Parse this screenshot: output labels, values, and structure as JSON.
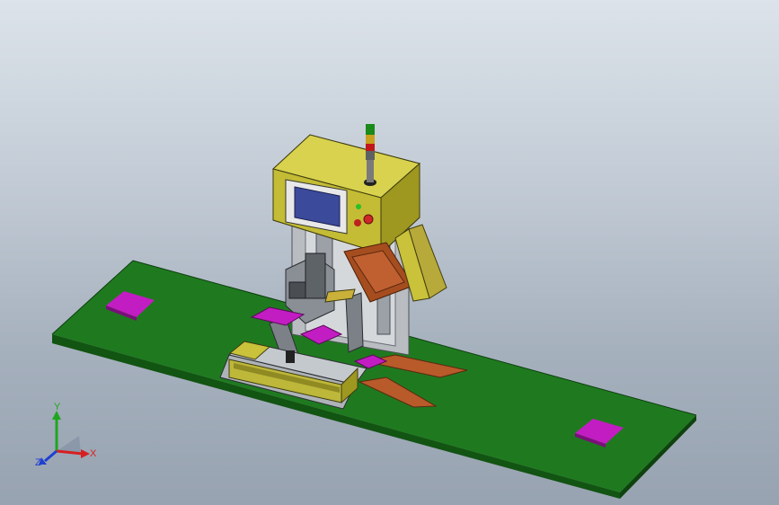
{
  "view": {
    "type": "3d-cad-model-viewport",
    "background_top": "#dce3ea",
    "background_bottom": "#98a3b1"
  },
  "colors": {
    "base_plate": "#1f7a1f",
    "base_plate_dark": "#125412",
    "housing": "#c9c23a",
    "housing_side": "#9e9720",
    "screen": "#3b4a9a",
    "pads": "#c21dc2",
    "copper": "#b85a2a",
    "steel": "#8a8f96"
  },
  "triad": {
    "x_label": "X",
    "y_label": "Y",
    "z_label": "Z",
    "x_color": "#d62020",
    "y_color": "#1fa61f",
    "z_color": "#2040d0"
  }
}
